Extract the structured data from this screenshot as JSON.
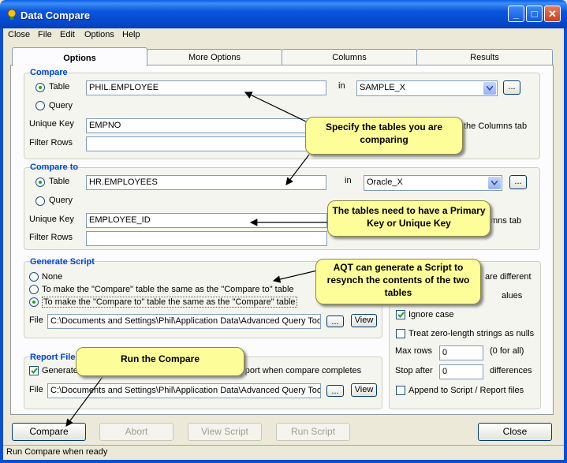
{
  "window": {
    "title": "Data Compare"
  },
  "menu": [
    "Close",
    "File",
    "Edit",
    "Options",
    "Help"
  ],
  "tabs": [
    "Options",
    "More Options",
    "Columns",
    "Results"
  ],
  "compare": {
    "title": "Compare",
    "radio_table": "Table",
    "radio_query": "Query",
    "table_value": "PHIL.EMPLOYEE",
    "in_label": "in",
    "db_value": "SAMPLE_X",
    "browse": "...",
    "unique_key_label": "Unique Key",
    "unique_key_value": "EMPNO",
    "columns_tab_hint": "the Columns tab",
    "filter_label": "Filter Rows"
  },
  "compare_to": {
    "title": "Compare to",
    "radio_table": "Table",
    "radio_query": "Query",
    "table_value": "HR.EMPLOYEES",
    "in_label": "in",
    "db_value": "Oracle_X",
    "browse": "...",
    "unique_key_label": "Unique Key",
    "unique_key_value": "EMPLOYEE_ID",
    "columns_tab_hint": "mns tab",
    "filter_label": "Filter Rows"
  },
  "generate_script": {
    "title": "Generate Script",
    "options": [
      "None",
      "To make the \"Compare\" table the same as the \"Compare to\" table",
      "To make the \"Compare to\" table the same as the \"Compare\" table"
    ],
    "file_label": "File",
    "file_value": "C:\\Documents and Settings\\Phil\\Application Data\\Advanced Query Too",
    "browse": "...",
    "view": "View"
  },
  "report_file": {
    "title": "Report File",
    "checkbox_label": "Generate",
    "checkbox_tail": "report when compare completes",
    "file_label": "File",
    "file_value": "C:\\Documents and Settings\\Phil\\Application Data\\Advanced Query Too",
    "browse": "...",
    "view": "View"
  },
  "options_panel": {
    "are_different": "are different",
    "values": "alues",
    "ignore_case": "Ignore case",
    "treat_zero": "Treat zero-length strings as nulls",
    "max_rows_label": "Max rows",
    "max_rows_value": "0",
    "max_rows_hint": "(0 for all)",
    "stop_after_label": "Stop after",
    "stop_after_value": "0",
    "stop_after_hint": "differences",
    "append": "Append to Script / Report files"
  },
  "buttons": {
    "compare": "Compare",
    "abort": "Abort",
    "view_script": "View Script",
    "run_script": "Run Script",
    "close": "Close"
  },
  "callouts": {
    "specify": "Specify the tables you are comparing",
    "keys": "The tables need to have a Primary Key or Unique Key",
    "script": "AQT can generate a Script to resynch the contents of the two tables",
    "run": "Run the Compare"
  },
  "status": "Run Compare when ready"
}
